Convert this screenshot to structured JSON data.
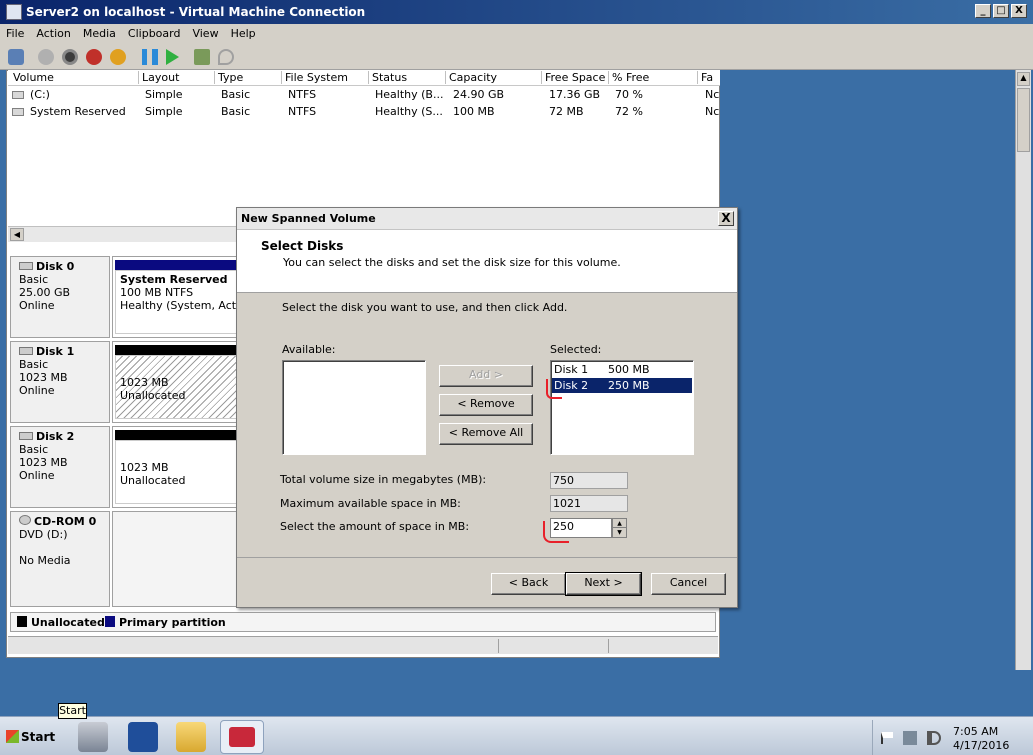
{
  "host": {
    "title": "Server2 on localhost - Virtual Machine Connection",
    "menu": [
      "File",
      "Action",
      "Media",
      "Clipboard",
      "View",
      "Help"
    ],
    "caption_buttons": [
      "_",
      "□",
      "X"
    ]
  },
  "volume_list": {
    "columns": [
      "Volume",
      "Layout",
      "Type",
      "File System",
      "Status",
      "Capacity",
      "Free Space",
      "% Free",
      "Fa"
    ],
    "rows": [
      [
        "(C:)",
        "Simple",
        "Basic",
        "NTFS",
        "Healthy (B...",
        "24.90 GB",
        "17.36 GB",
        "70 %",
        "Nc"
      ],
      [
        "System Reserved",
        "Simple",
        "Basic",
        "NTFS",
        "Healthy (S...",
        "100 MB",
        "72 MB",
        "72 %",
        "Nc"
      ]
    ]
  },
  "disks": [
    {
      "name": "Disk 0",
      "type": "Basic",
      "size": "25.00 GB",
      "state": "Online",
      "part_title": "System Reserved",
      "part_line1": "100 MB NTFS",
      "part_line2": "Healthy (System, Active"
    },
    {
      "name": "Disk 1",
      "type": "Basic",
      "size": "1023 MB",
      "state": "Online",
      "part_line1": "1023 MB",
      "part_line2": "Unallocated"
    },
    {
      "name": "Disk 2",
      "type": "Basic",
      "size": "1023 MB",
      "state": "Online",
      "part_line1": "1023 MB",
      "part_line2": "Unallocated"
    },
    {
      "name": "CD-ROM 0",
      "type": "DVD (D:)",
      "state": "No Media"
    }
  ],
  "legend": {
    "unallocated": "Unallocated",
    "primary": "Primary partition"
  },
  "wizard": {
    "title": "New Spanned Volume",
    "close": "X",
    "heading": "Select Disks",
    "subheading": "You can select the disks and set the disk size for this volume.",
    "instruction": "Select the disk you want to use, and then click Add.",
    "available_label": "Available:",
    "selected_label": "Selected:",
    "selected_items": [
      {
        "disk": "Disk 1",
        "size": "500 MB"
      },
      {
        "disk": "Disk 2",
        "size": "250 MB"
      }
    ],
    "add_label": "Add >",
    "remove_label": "< Remove",
    "remove_all_label": "< Remove All",
    "total_label": "Total volume size in megabytes (MB):",
    "total_value": "750",
    "max_label": "Maximum available space in MB:",
    "max_value": "1021",
    "amount_label": "Select the amount of space in MB:",
    "amount_value": "250",
    "back_label": "< Back",
    "next_label": "Next >",
    "cancel_label": "Cancel"
  },
  "taskbar": {
    "start_label": "Start",
    "tooltip": "Start",
    "time": "7:05 AM",
    "date": "4/17/2016"
  },
  "colors": {
    "desktop": "#3a6ea5",
    "selection": "#0a246a",
    "primary_partition": "#0a0a80",
    "unallocated": "#000000",
    "annotation": "#e8202a"
  }
}
